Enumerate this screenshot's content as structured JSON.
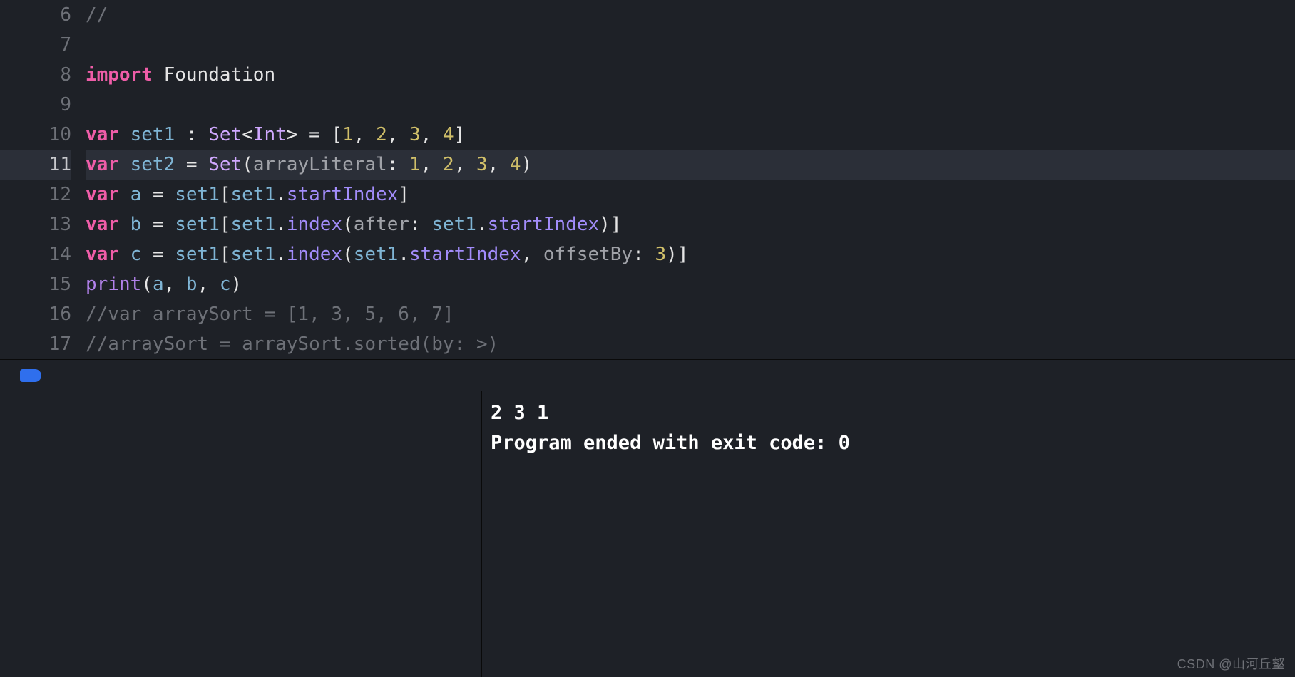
{
  "editor": {
    "lines": [
      {
        "num": "6",
        "highlight": false,
        "tokens": [
          {
            "cls": "tok-comment",
            "t": "//"
          }
        ]
      },
      {
        "num": "7",
        "highlight": false,
        "tokens": [
          {
            "cls": "",
            "t": ""
          }
        ]
      },
      {
        "num": "8",
        "highlight": false,
        "tokens": [
          {
            "cls": "tok-keyword",
            "t": "import"
          },
          {
            "cls": "",
            "t": " "
          },
          {
            "cls": "tok-ident",
            "t": "Foundation"
          }
        ]
      },
      {
        "num": "9",
        "highlight": false,
        "tokens": [
          {
            "cls": "",
            "t": ""
          }
        ]
      },
      {
        "num": "10",
        "highlight": false,
        "tokens": [
          {
            "cls": "tok-keyword",
            "t": "var"
          },
          {
            "cls": "",
            "t": " "
          },
          {
            "cls": "tok-var",
            "t": "set1"
          },
          {
            "cls": "",
            "t": " "
          },
          {
            "cls": "tok-punct",
            "t": ":"
          },
          {
            "cls": "",
            "t": " "
          },
          {
            "cls": "tok-type",
            "t": "Set"
          },
          {
            "cls": "tok-punct",
            "t": "<"
          },
          {
            "cls": "tok-type",
            "t": "Int"
          },
          {
            "cls": "tok-punct",
            "t": ">"
          },
          {
            "cls": "",
            "t": " "
          },
          {
            "cls": "tok-punct",
            "t": "="
          },
          {
            "cls": "",
            "t": " "
          },
          {
            "cls": "tok-punct",
            "t": "["
          },
          {
            "cls": "tok-number",
            "t": "1"
          },
          {
            "cls": "tok-punct",
            "t": ", "
          },
          {
            "cls": "tok-number",
            "t": "2"
          },
          {
            "cls": "tok-punct",
            "t": ", "
          },
          {
            "cls": "tok-number",
            "t": "3"
          },
          {
            "cls": "tok-punct",
            "t": ", "
          },
          {
            "cls": "tok-number",
            "t": "4"
          },
          {
            "cls": "tok-punct",
            "t": "]"
          }
        ]
      },
      {
        "num": "11",
        "highlight": true,
        "tokens": [
          {
            "cls": "tok-keyword",
            "t": "var"
          },
          {
            "cls": "",
            "t": " "
          },
          {
            "cls": "tok-var",
            "t": "set2"
          },
          {
            "cls": "",
            "t": " "
          },
          {
            "cls": "tok-punct",
            "t": "="
          },
          {
            "cls": "",
            "t": " "
          },
          {
            "cls": "tok-type",
            "t": "Set"
          },
          {
            "cls": "tok-paren",
            "t": "("
          },
          {
            "cls": "tok-arglabel",
            "t": "arrayLiteral"
          },
          {
            "cls": "tok-punct",
            "t": ": "
          },
          {
            "cls": "tok-number",
            "t": "1"
          },
          {
            "cls": "tok-punct",
            "t": ", "
          },
          {
            "cls": "tok-number",
            "t": "2"
          },
          {
            "cls": "tok-punct",
            "t": ", "
          },
          {
            "cls": "tok-number",
            "t": "3"
          },
          {
            "cls": "tok-punct",
            "t": ", "
          },
          {
            "cls": "tok-number",
            "t": "4"
          },
          {
            "cls": "tok-paren",
            "t": ")"
          }
        ]
      },
      {
        "num": "12",
        "highlight": false,
        "tokens": [
          {
            "cls": "tok-keyword",
            "t": "var"
          },
          {
            "cls": "",
            "t": " "
          },
          {
            "cls": "tok-var",
            "t": "a"
          },
          {
            "cls": "",
            "t": " "
          },
          {
            "cls": "tok-punct",
            "t": "="
          },
          {
            "cls": "",
            "t": " "
          },
          {
            "cls": "tok-var",
            "t": "set1"
          },
          {
            "cls": "tok-punct",
            "t": "["
          },
          {
            "cls": "tok-var",
            "t": "set1"
          },
          {
            "cls": "tok-punct",
            "t": "."
          },
          {
            "cls": "tok-prop",
            "t": "startIndex"
          },
          {
            "cls": "tok-punct",
            "t": "]"
          }
        ]
      },
      {
        "num": "13",
        "highlight": false,
        "tokens": [
          {
            "cls": "tok-keyword",
            "t": "var"
          },
          {
            "cls": "",
            "t": " "
          },
          {
            "cls": "tok-var",
            "t": "b"
          },
          {
            "cls": "",
            "t": " "
          },
          {
            "cls": "tok-punct",
            "t": "="
          },
          {
            "cls": "",
            "t": " "
          },
          {
            "cls": "tok-var",
            "t": "set1"
          },
          {
            "cls": "tok-punct",
            "t": "["
          },
          {
            "cls": "tok-var",
            "t": "set1"
          },
          {
            "cls": "tok-punct",
            "t": "."
          },
          {
            "cls": "tok-func",
            "t": "index"
          },
          {
            "cls": "tok-paren",
            "t": "("
          },
          {
            "cls": "tok-arglabel",
            "t": "after"
          },
          {
            "cls": "tok-punct",
            "t": ": "
          },
          {
            "cls": "tok-var",
            "t": "set1"
          },
          {
            "cls": "tok-punct",
            "t": "."
          },
          {
            "cls": "tok-prop",
            "t": "startIndex"
          },
          {
            "cls": "tok-paren",
            "t": ")"
          },
          {
            "cls": "tok-punct",
            "t": "]"
          }
        ]
      },
      {
        "num": "14",
        "highlight": false,
        "tokens": [
          {
            "cls": "tok-keyword",
            "t": "var"
          },
          {
            "cls": "",
            "t": " "
          },
          {
            "cls": "tok-var",
            "t": "c"
          },
          {
            "cls": "",
            "t": " "
          },
          {
            "cls": "tok-punct",
            "t": "="
          },
          {
            "cls": "",
            "t": " "
          },
          {
            "cls": "tok-var",
            "t": "set1"
          },
          {
            "cls": "tok-punct",
            "t": "["
          },
          {
            "cls": "tok-var",
            "t": "set1"
          },
          {
            "cls": "tok-punct",
            "t": "."
          },
          {
            "cls": "tok-func",
            "t": "index"
          },
          {
            "cls": "tok-paren",
            "t": "("
          },
          {
            "cls": "tok-var",
            "t": "set1"
          },
          {
            "cls": "tok-punct",
            "t": "."
          },
          {
            "cls": "tok-prop",
            "t": "startIndex"
          },
          {
            "cls": "tok-punct",
            "t": ", "
          },
          {
            "cls": "tok-arglabel",
            "t": "offsetBy"
          },
          {
            "cls": "tok-punct",
            "t": ": "
          },
          {
            "cls": "tok-number",
            "t": "3"
          },
          {
            "cls": "tok-paren",
            "t": ")"
          },
          {
            "cls": "tok-punct",
            "t": "]"
          }
        ]
      },
      {
        "num": "15",
        "highlight": false,
        "tokens": [
          {
            "cls": "tok-call",
            "t": "print"
          },
          {
            "cls": "tok-paren",
            "t": "("
          },
          {
            "cls": "tok-var",
            "t": "a"
          },
          {
            "cls": "tok-punct",
            "t": ", "
          },
          {
            "cls": "tok-var",
            "t": "b"
          },
          {
            "cls": "tok-punct",
            "t": ", "
          },
          {
            "cls": "tok-var",
            "t": "c"
          },
          {
            "cls": "tok-paren",
            "t": ")"
          }
        ]
      },
      {
        "num": "16",
        "highlight": false,
        "tokens": [
          {
            "cls": "tok-comment",
            "t": "//var arraySort = [1, 3, 5, 6, 7]"
          }
        ]
      },
      {
        "num": "17",
        "highlight": false,
        "tokens": [
          {
            "cls": "tok-comment",
            "t": "//arraySort = arraySort.sorted(by: >)"
          }
        ]
      }
    ]
  },
  "console": {
    "line1": "2 3 1",
    "line2": "Program ended with exit code: 0"
  },
  "watermark": "CSDN @山河丘壑"
}
